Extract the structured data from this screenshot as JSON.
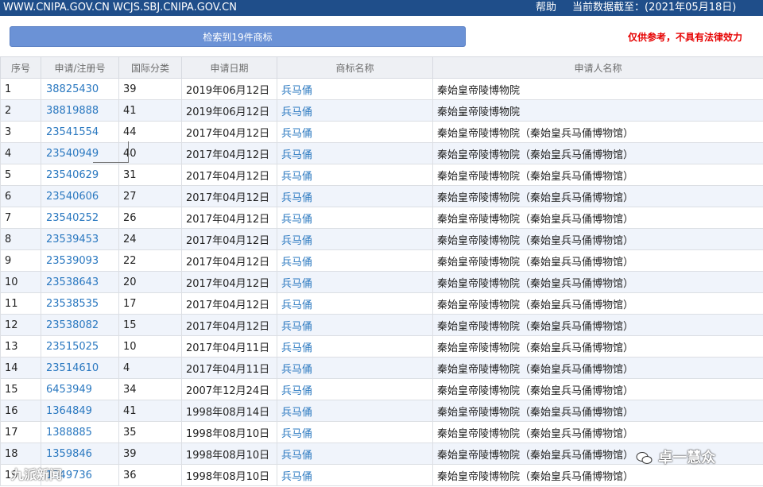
{
  "header": {
    "sites": "WWW.CNIPA.GOV.CN WCJS.SBJ.CNIPA.GOV.CN",
    "help": "帮助",
    "as_of": "当前数据截至：(2021年05月18日)"
  },
  "toolbar": {
    "result_label": "检索到19件商标",
    "disclaimer": "仅供参考，不具有法律效力"
  },
  "table": {
    "columns": [
      "序号",
      "申请/注册号",
      "国际分类",
      "申请日期",
      "商标名称",
      "申请人名称"
    ],
    "rows": [
      {
        "no": "1",
        "reg": "38825430",
        "cls": "39",
        "date": "2019年06月12日",
        "name": "兵马俑",
        "applicant": "秦始皇帝陵博物院"
      },
      {
        "no": "2",
        "reg": "38819888",
        "cls": "41",
        "date": "2019年06月12日",
        "name": "兵马俑",
        "applicant": "秦始皇帝陵博物院"
      },
      {
        "no": "3",
        "reg": "23541554",
        "cls": "44",
        "date": "2017年04月12日",
        "name": "兵马俑",
        "applicant": "秦始皇帝陵博物院（秦始皇兵马俑博物馆）"
      },
      {
        "no": "4",
        "reg": "23540949",
        "cls": "40",
        "date": "2017年04月12日",
        "name": "兵马俑",
        "applicant": "秦始皇帝陵博物院（秦始皇兵马俑博物馆）"
      },
      {
        "no": "5",
        "reg": "23540629",
        "cls": "31",
        "date": "2017年04月12日",
        "name": "兵马俑",
        "applicant": "秦始皇帝陵博物院（秦始皇兵马俑博物馆）"
      },
      {
        "no": "6",
        "reg": "23540606",
        "cls": "27",
        "date": "2017年04月12日",
        "name": "兵马俑",
        "applicant": "秦始皇帝陵博物院（秦始皇兵马俑博物馆）"
      },
      {
        "no": "7",
        "reg": "23540252",
        "cls": "26",
        "date": "2017年04月12日",
        "name": "兵马俑",
        "applicant": "秦始皇帝陵博物院（秦始皇兵马俑博物馆）"
      },
      {
        "no": "8",
        "reg": "23539453",
        "cls": "24",
        "date": "2017年04月12日",
        "name": "兵马俑",
        "applicant": "秦始皇帝陵博物院（秦始皇兵马俑博物馆）"
      },
      {
        "no": "9",
        "reg": "23539093",
        "cls": "22",
        "date": "2017年04月12日",
        "name": "兵马俑",
        "applicant": "秦始皇帝陵博物院（秦始皇兵马俑博物馆）"
      },
      {
        "no": "10",
        "reg": "23538643",
        "cls": "20",
        "date": "2017年04月12日",
        "name": "兵马俑",
        "applicant": "秦始皇帝陵博物院（秦始皇兵马俑博物馆）"
      },
      {
        "no": "11",
        "reg": "23538535",
        "cls": "17",
        "date": "2017年04月12日",
        "name": "兵马俑",
        "applicant": "秦始皇帝陵博物院（秦始皇兵马俑博物馆）"
      },
      {
        "no": "12",
        "reg": "23538082",
        "cls": "15",
        "date": "2017年04月12日",
        "name": "兵马俑",
        "applicant": "秦始皇帝陵博物院（秦始皇兵马俑博物馆）"
      },
      {
        "no": "13",
        "reg": "23515025",
        "cls": "10",
        "date": "2017年04月11日",
        "name": "兵马俑",
        "applicant": "秦始皇帝陵博物院（秦始皇兵马俑博物馆）"
      },
      {
        "no": "14",
        "reg": "23514610",
        "cls": "4",
        "date": "2017年04月11日",
        "name": "兵马俑",
        "applicant": "秦始皇帝陵博物院（秦始皇兵马俑博物馆）"
      },
      {
        "no": "15",
        "reg": "6453949",
        "cls": "34",
        "date": "2007年12月24日",
        "name": "兵马俑",
        "applicant": "秦始皇帝陵博物院（秦始皇兵马俑博物馆）"
      },
      {
        "no": "16",
        "reg": "1364849",
        "cls": "41",
        "date": "1998年08月14日",
        "name": "兵马俑",
        "applicant": "秦始皇帝陵博物院（秦始皇兵马俑博物馆）"
      },
      {
        "no": "17",
        "reg": "1388885",
        "cls": "35",
        "date": "1998年08月10日",
        "name": "兵马俑",
        "applicant": "秦始皇帝陵博物院（秦始皇兵马俑博物馆）"
      },
      {
        "no": "18",
        "reg": "1359846",
        "cls": "39",
        "date": "1998年08月10日",
        "name": "兵马俑",
        "applicant": "秦始皇帝陵博物院（秦始皇兵马俑博物馆）"
      },
      {
        "no": "19",
        "reg": "1349736",
        "cls": "36",
        "date": "1998年08月10日",
        "name": "兵马俑",
        "applicant": "秦始皇帝陵博物院（秦始皇兵马俑博物馆）"
      }
    ]
  },
  "watermarks": {
    "left": "九派新闻",
    "right": "卓一慧众",
    "right_icon": "wechat-icon"
  },
  "colors": {
    "header_bg": "#1f4e8a",
    "button_bg": "#6b92d6",
    "disclaimer": "#e60000",
    "link": "#2a78c0",
    "row_alt": "#f0f4fb"
  }
}
